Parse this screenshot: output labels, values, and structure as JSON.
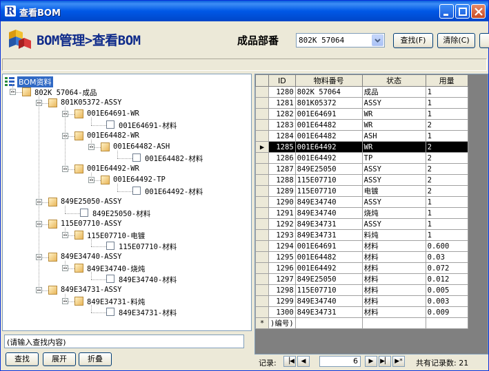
{
  "window": {
    "title": "查看BOM",
    "app_icon_letter": "R"
  },
  "header": {
    "page_title": "BOM管理>查看BOM",
    "field_label": "成品部番",
    "combo_value": "802K 57064",
    "find_button": "查找(F)",
    "clear_button": "清除(C)"
  },
  "tree": {
    "root": "BOM资料",
    "nodes": [
      {
        "label": "802K 57064-成品",
        "level": 0,
        "type": "node"
      },
      {
        "label": "801K05372-ASSY",
        "level": 1,
        "type": "node"
      },
      {
        "label": "001E64691-WR",
        "level": 2,
        "type": "node"
      },
      {
        "label": "001E64691-材料",
        "level": 3,
        "type": "leaf"
      },
      {
        "label": "001E64482-WR",
        "level": 2,
        "type": "node"
      },
      {
        "label": "001E64482-ASH",
        "level": 3,
        "type": "node"
      },
      {
        "label": "001E64482-材料",
        "level": 4,
        "type": "leaf"
      },
      {
        "label": "001E64492-WR",
        "level": 2,
        "type": "node"
      },
      {
        "label": "001E64492-TP",
        "level": 3,
        "type": "node"
      },
      {
        "label": "001E64492-材料",
        "level": 4,
        "type": "leaf"
      },
      {
        "label": "849E25050-ASSY",
        "level": 1,
        "type": "node"
      },
      {
        "label": "849E25050-材料",
        "level": 2,
        "type": "leaf"
      },
      {
        "label": "115E07710-ASSY",
        "level": 1,
        "type": "node"
      },
      {
        "label": "115E07710-电镀",
        "level": 2,
        "type": "node"
      },
      {
        "label": "115E07710-材料",
        "level": 3,
        "type": "leaf"
      },
      {
        "label": "849E34740-ASSY",
        "level": 1,
        "type": "node"
      },
      {
        "label": "849E34740-烧炖",
        "level": 2,
        "type": "node"
      },
      {
        "label": "849E34740-材料",
        "level": 3,
        "type": "leaf"
      },
      {
        "label": "849E34731-ASSY",
        "level": 1,
        "type": "node"
      },
      {
        "label": "849E34731-料炖",
        "level": 2,
        "type": "node"
      },
      {
        "label": "849E34731-材料",
        "level": 3,
        "type": "leaf"
      }
    ],
    "search_placeholder": "(请输入查找内容)",
    "btn_find": "查找",
    "btn_expand": "展开",
    "btn_collapse": "折叠"
  },
  "grid": {
    "columns": [
      "ID",
      "物料番号",
      "状态",
      "用量"
    ],
    "rows": [
      [
        "1280",
        "802K 57064",
        "成品",
        "1"
      ],
      [
        "1281",
        "801K05372",
        "ASSY",
        "1"
      ],
      [
        "1282",
        "001E64691",
        "WR",
        "1"
      ],
      [
        "1283",
        "001E64482",
        "WR",
        "2"
      ],
      [
        "1284",
        "001E64482",
        "ASH",
        "1"
      ],
      [
        "1285",
        "001E64492",
        "WR",
        "2"
      ],
      [
        "1286",
        "001E64492",
        "TP",
        "2"
      ],
      [
        "1287",
        "849E25050",
        "ASSY",
        "2"
      ],
      [
        "1288",
        "115E07710",
        "ASSY",
        "2"
      ],
      [
        "1289",
        "115E07710",
        "电镀",
        "2"
      ],
      [
        "1290",
        "849E34740",
        "ASSY",
        "1"
      ],
      [
        "1291",
        "849E34740",
        "烧炖",
        "1"
      ],
      [
        "1292",
        "849E34731",
        "ASSY",
        "1"
      ],
      [
        "1293",
        "849E34731",
        "料炖",
        "1"
      ],
      [
        "1294",
        "001E64691",
        "材料",
        "0.600"
      ],
      [
        "1295",
        "001E64482",
        "材料",
        "0.03"
      ],
      [
        "1296",
        "001E64492",
        "材料",
        "0.072"
      ],
      [
        "1297",
        "849E25050",
        "材料",
        "0.012"
      ],
      [
        "1298",
        "115E07710",
        "材料",
        "0.005"
      ],
      [
        "1299",
        "849E34740",
        "材料",
        "0.003"
      ],
      [
        "1300",
        "849E34731",
        "材料",
        "0.009"
      ]
    ],
    "selected_index": 5,
    "new_row_marker": "*",
    "new_row_text": ")编号)"
  },
  "navigator": {
    "label": "记录:",
    "current": "6",
    "total_text": "共有记录数: 21"
  }
}
